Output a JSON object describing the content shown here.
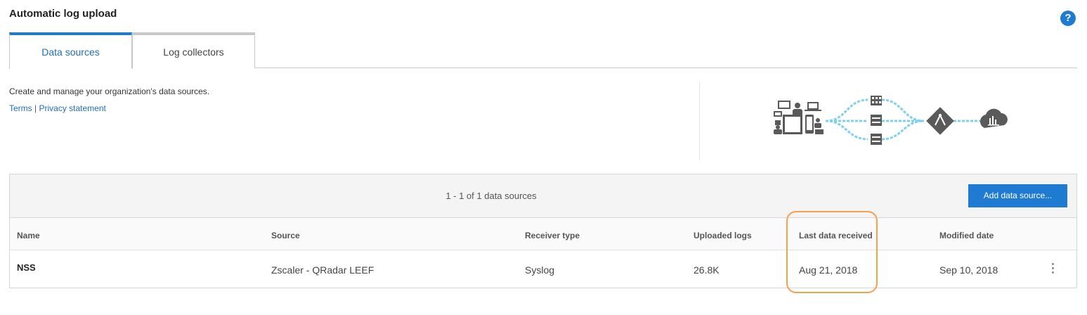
{
  "page": {
    "title": "Automatic log upload"
  },
  "tabs": [
    {
      "label": "Data sources",
      "active": true
    },
    {
      "label": "Log collectors",
      "active": false
    }
  ],
  "intro": {
    "description": "Create and manage your organization's data sources.",
    "terms_link": "Terms",
    "separator": "|",
    "privacy_link": "Privacy statement"
  },
  "toolbar": {
    "count_text": "1 - 1 of 1 data sources",
    "add_button_label": "Add data source..."
  },
  "table": {
    "columns": [
      "Name",
      "Source",
      "Receiver type",
      "Uploaded logs",
      "Last data received",
      "Modified date"
    ],
    "rows": [
      [
        "NSS",
        "Zscaler - QRadar LEEF",
        "Syslog",
        "26.8K",
        "Aug 21, 2018",
        "Sep 10, 2018"
      ]
    ]
  },
  "icons": {
    "help": "?",
    "help_color": "#1e7bd1",
    "accent": "#1e7bd1",
    "highlight": "#f5a04a",
    "flow_line": "#7fd0f0"
  }
}
